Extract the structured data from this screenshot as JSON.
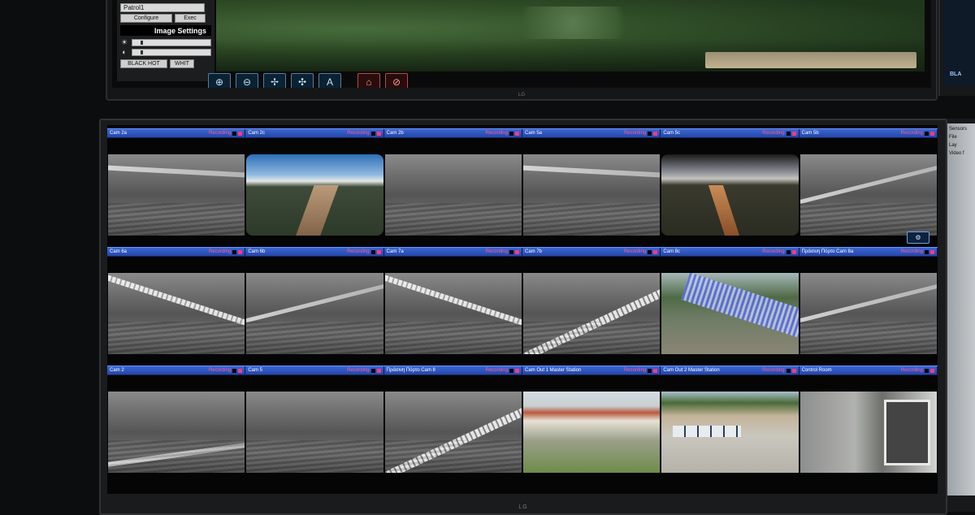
{
  "top_panel": {
    "preset_value": "Patrol1",
    "configure_label": "Configure",
    "execute_label": "Exec",
    "image_settings_title": "Image Settings",
    "black_hot_label": "BLACK HOT",
    "white_hot_label": "WHIT",
    "brand": "LG"
  },
  "toolbar": {
    "icons": [
      "zoom-in-icon",
      "zoom-out-icon",
      "focus-near-icon",
      "focus-far-icon",
      "auto-focus-icon",
      "home-position-icon",
      "stop-tour-icon"
    ]
  },
  "side_monitor": {
    "tag": "BLA",
    "menu": [
      "Sensors",
      "File",
      "Lay",
      "Video f"
    ]
  },
  "main": {
    "brand": "LG",
    "rows": [
      {
        "cams": [
          {
            "name": "Cam 2a",
            "rec": "Recording"
          },
          {
            "name": "Cam 2c",
            "rec": "Recording"
          },
          {
            "name": "Cam 2b",
            "rec": "Recording"
          },
          {
            "name": "Cam 5a",
            "rec": "Recording"
          },
          {
            "name": "Cam 5c",
            "rec": "Recording"
          },
          {
            "name": "Cam 5b",
            "rec": "Recording"
          }
        ]
      },
      {
        "cams": [
          {
            "name": "Cam 6a",
            "rec": "Recording"
          },
          {
            "name": "Cam 6b",
            "rec": "Recording"
          },
          {
            "name": "Cam 7a",
            "rec": "Recording"
          },
          {
            "name": "Cam 7b",
            "rec": "Recording"
          },
          {
            "name": "Cam 8c",
            "rec": "Recording"
          },
          {
            "name": "Πράσινη Πόρτο Cam 8a",
            "rec": "Recording"
          }
        ]
      },
      {
        "cams": [
          {
            "name": "Cam 2",
            "rec": "Recording"
          },
          {
            "name": "Cam 5",
            "rec": "Recording"
          },
          {
            "name": "Πράσινη Πόρτο Cam 8",
            "rec": "Recording"
          },
          {
            "name": "Cam Out 1 Master Station",
            "rec": "Recording"
          },
          {
            "name": "Cam Out 2 Master Station",
            "rec": "Recording"
          },
          {
            "name": "Control Room",
            "rec": "Recording"
          }
        ]
      }
    ]
  }
}
